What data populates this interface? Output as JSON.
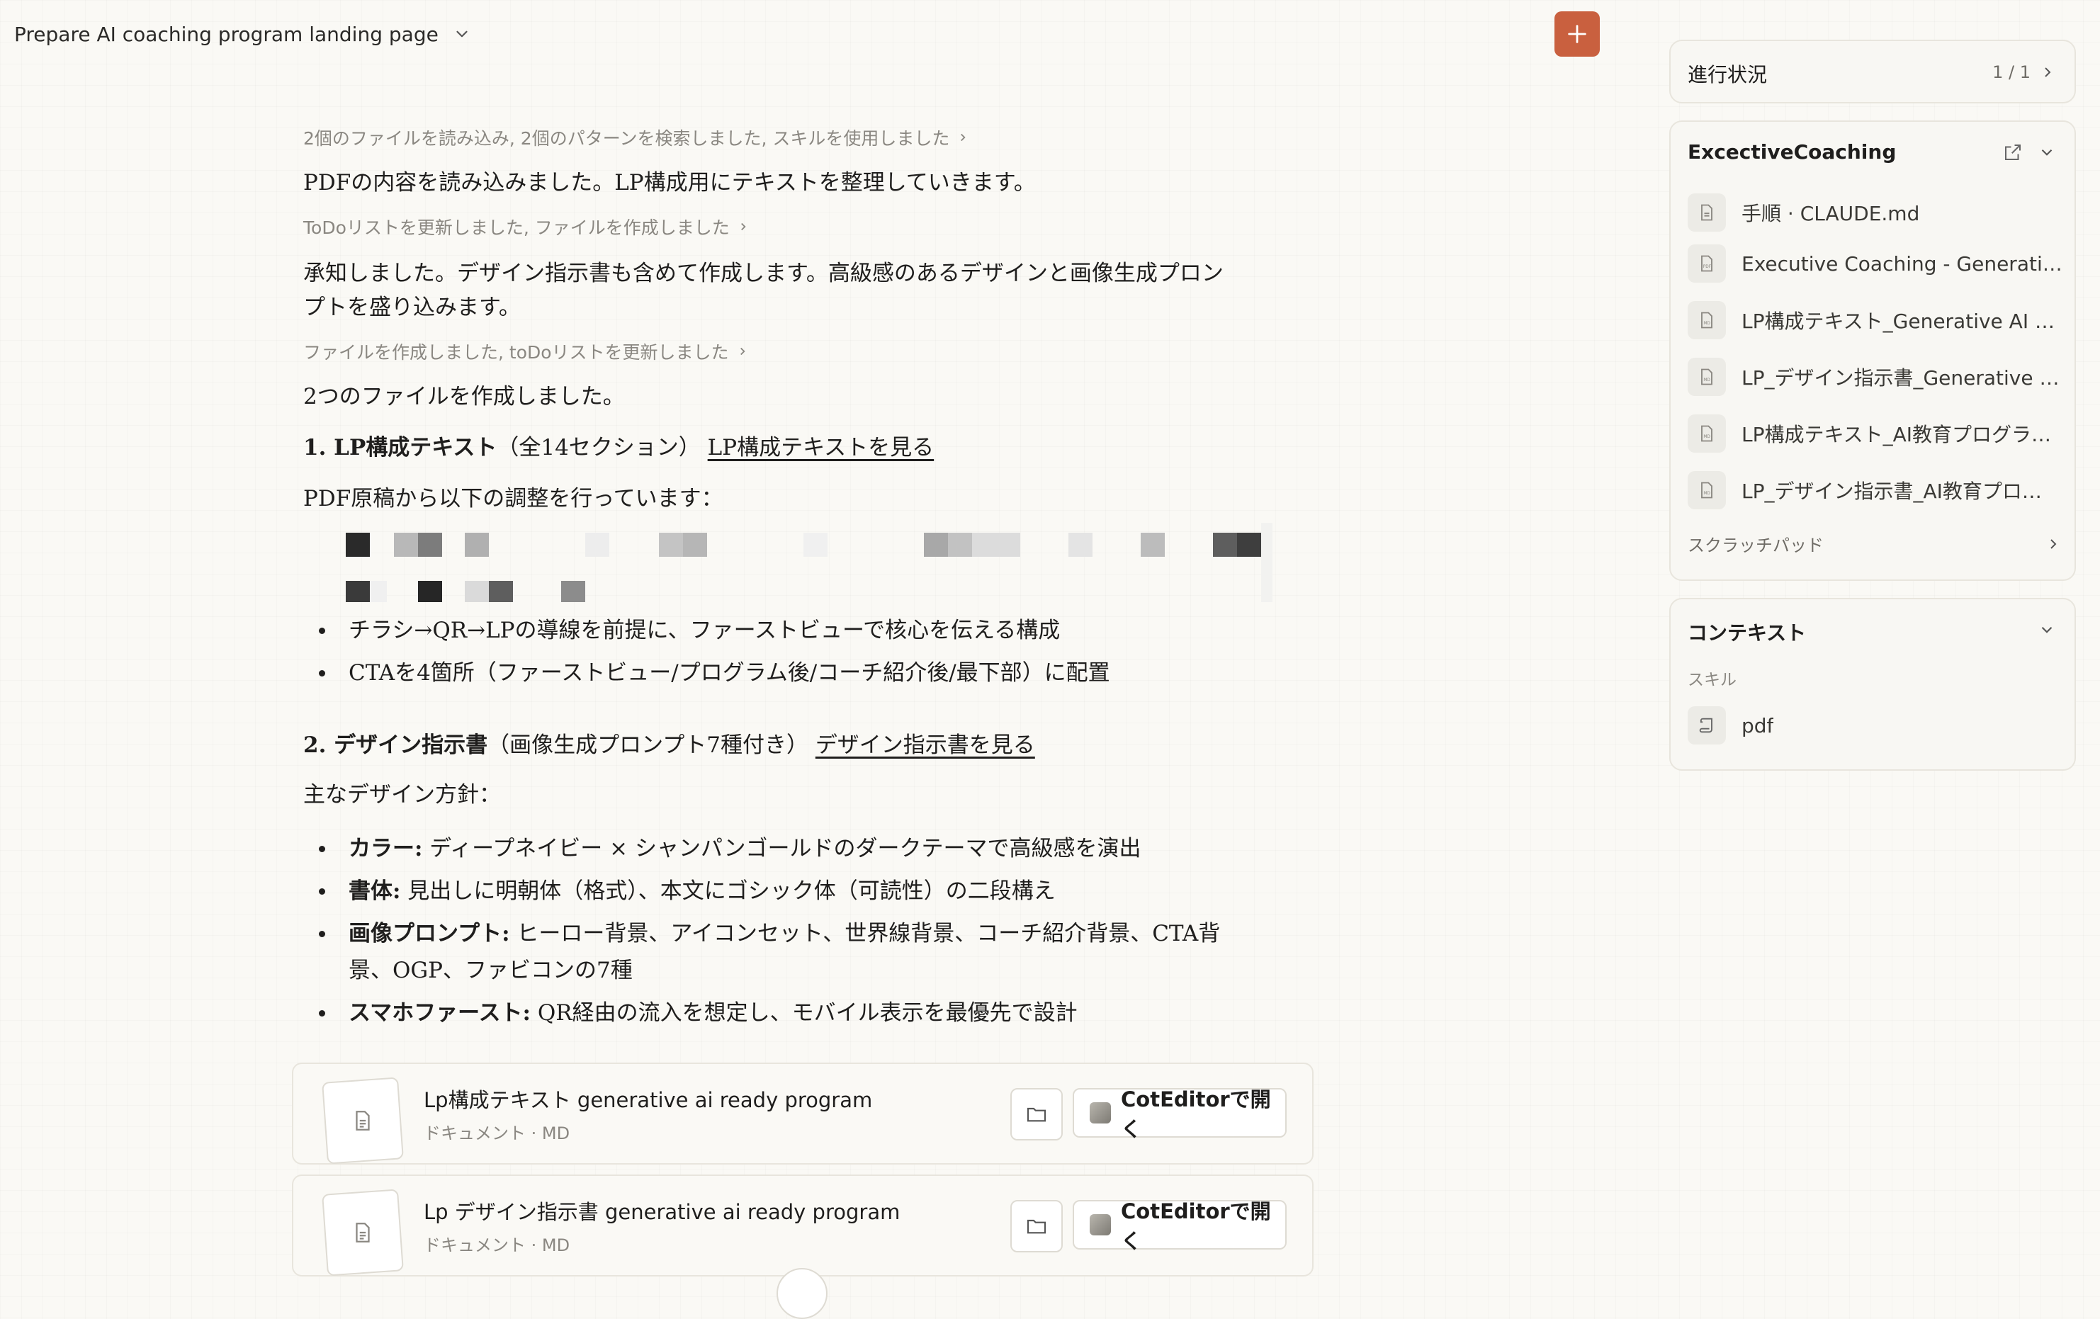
{
  "header": {
    "title": "Prepare AI coaching program landing page",
    "new_button_label": "+"
  },
  "chat": {
    "meta1": "2個のファイルを読み込み, 2個のパターンを検索しました, スキルを使用しました",
    "msg1": "PDFの内容を読み込みました。LP構成用にテキストを整理していきます。",
    "meta2": "ToDoリストを更新しました, ファイルを作成しました",
    "msg2_line1": "承知しました。デザイン指示書も含めて作成します。高級感のあるデザインと画像生成プロン",
    "msg2_line2": "プトを盛り込みます。",
    "meta3": "ファイルを作成しました, toDoリストを更新しました",
    "msg3": "2つのファイルを作成しました。",
    "section1_bold": "1. LP構成テキスト",
    "section1_rest": "（全14セクション）",
    "section1_link": "LP構成テキストを見る",
    "section1_intro": "PDF原稿から以下の調整を行っています：",
    "section1_bullets": [
      "チラシ→QR→LPの導線を前提に、ファーストビューで核心を伝える構成",
      "CTAを4箇所（ファーストビュー/プログラム後/コーチ紹介後/最下部）に配置"
    ],
    "section2_bold": "2. デザイン指示書",
    "section2_rest": "（画像生成プロンプト7種付き）",
    "section2_link": "デザイン指示書を見る",
    "section2_intro": "主なデザイン方針：",
    "section2_bullets": [
      {
        "label": "カラー:",
        "text": " ディープネイビー × シャンパンゴールドのダークテーマで高級感を演出"
      },
      {
        "label": "書体:",
        "text": " 見出しに明朝体（格式）、本文にゴシック体（可読性）の二段構え"
      },
      {
        "label": "画像プロンプト:",
        "text": " ヒーロー背景、アイコンセット、世界線背景、コーチ紹介背景、CTA背",
        "text2": "景、OGP、ファビコンの7種"
      },
      {
        "label": "スマホファースト:",
        "text": " QR経由の流入を想定し、モバイル表示を最優先で設計"
      }
    ]
  },
  "files": [
    {
      "name": "Lp構成テキスト generative ai ready program",
      "type": "ドキュメント · MD",
      "open_label": "CotEditorで開く"
    },
    {
      "name": "Lp デザイン指示書 generative ai ready program",
      "type": "ドキュメント · MD",
      "open_label": "CotEditorで開く"
    }
  ],
  "sidebar": {
    "progress_label": "進行状況",
    "progress_count": "1 / 1",
    "folder_title": "ExcectiveCoaching",
    "folder_files": [
      {
        "label": "手順 · CLAUDE.md",
        "icon": "doc-icon"
      },
      {
        "label": "Executive Coaching - Generativ…",
        "icon": "pdf-icon"
      },
      {
        "label": "LP構成テキスト_Generative AI R…",
        "icon": "md-icon"
      },
      {
        "label": "LP_デザイン指示書_Generative …",
        "icon": "md-icon"
      },
      {
        "label": "LP構成テキスト_AI教育プログラ…",
        "icon": "md-icon"
      },
      {
        "label": "LP_デザイン指示書_AI教育プロ…",
        "icon": "md-icon"
      }
    ],
    "scratchpad_label": "スクラッチパッド",
    "context_title": "コンテキスト",
    "skill_label": "スキル",
    "skill_item": "pdf"
  }
}
